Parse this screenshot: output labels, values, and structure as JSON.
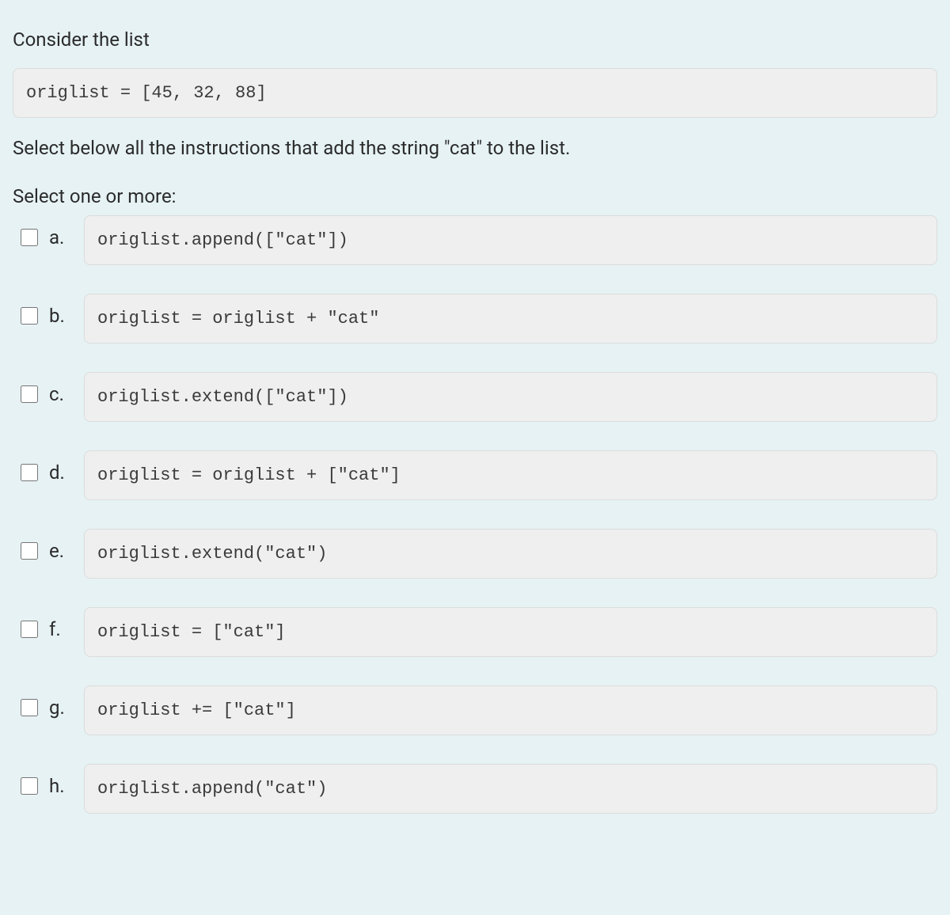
{
  "question": {
    "intro": "Consider the list",
    "code": "origlist = [45, 32, 88]",
    "instruction": "Select below all the instructions that add the string \"cat\" to the list.",
    "select_prompt": "Select one or more:"
  },
  "options": [
    {
      "label": "a.",
      "code": "origlist.append([\"cat\"])"
    },
    {
      "label": "b.",
      "code": "origlist = origlist + \"cat\""
    },
    {
      "label": "c.",
      "code": "origlist.extend([\"cat\"])"
    },
    {
      "label": "d.",
      "code": "origlist = origlist + [\"cat\"]"
    },
    {
      "label": "e.",
      "code": "origlist.extend(\"cat\")"
    },
    {
      "label": "f.",
      "code": "origlist = [\"cat\"]"
    },
    {
      "label": "g.",
      "code": "origlist += [\"cat\"]"
    },
    {
      "label": "h.",
      "code": "origlist.append(\"cat\")"
    }
  ]
}
